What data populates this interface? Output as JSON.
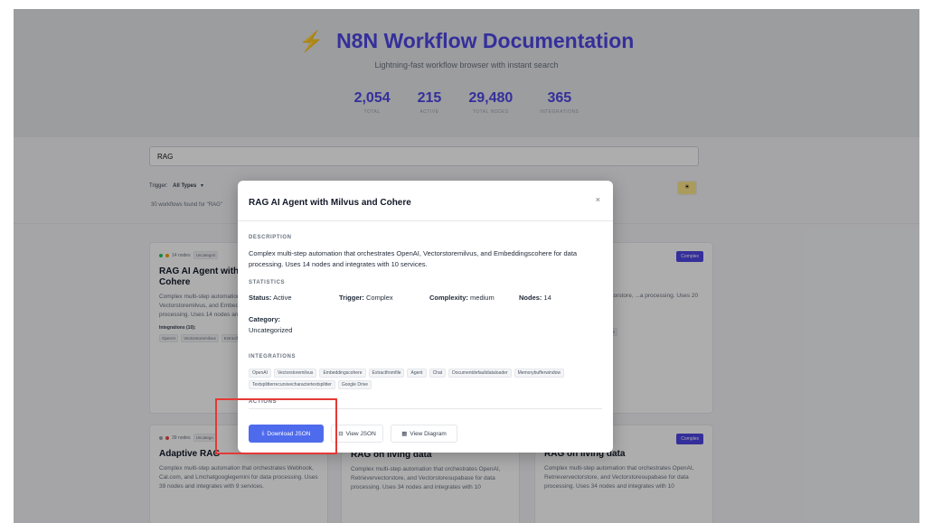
{
  "header": {
    "title": "N8N Workflow Documentation",
    "subtitle": "Lightning-fast workflow browser with instant search",
    "stats": [
      {
        "value": "2,054",
        "label": "TOTAL"
      },
      {
        "value": "215",
        "label": "ACTIVE"
      },
      {
        "value": "29,480",
        "label": "TOTAL NODES"
      },
      {
        "value": "365",
        "label": "INTEGRATIONS"
      }
    ]
  },
  "search": {
    "value": "RAG"
  },
  "filters": {
    "trigger_label": "Trigger:",
    "trigger_value": "All Types",
    "found_text": "30 workflows found for \"RAG\""
  },
  "cards": [
    {
      "nodes": "14 nodes",
      "category": "Uncategori",
      "title": "RAG AI Agent with Milvus and Cohere",
      "desc": "Complex multi-step automation that orchestrates OpenAI, Vectorstoremilvus, and Embeddingscohere for data processing. Uses 14 nodes and integrates with 10 services.",
      "integrations_label": "Integrations (10):",
      "chips": [
        "OpenAI",
        "Vectorstoremilvus",
        "Extractfromfile",
        "Agent"
      ]
    },
    {
      "category": "tion &",
      "complexity": "Complex",
      "desc": "...omation that ...rievervectorstore, ...a processing. Uses 20 ...ith 9 services.",
      "chips": [
        "...ee",
        "Lmchatgroq",
        "...ran",
        "+4"
      ]
    },
    {
      "nodes": "39 nodes",
      "category": "Uncatego",
      "title": "Adaptive RAG",
      "desc": "Complex multi-step automation that orchestrates Webhook, Cal.com, and Lmchatgooglegemini for data processing. Uses 39 nodes and integrates with 9 services."
    },
    {
      "title": "RAG on living data",
      "desc": "Complex multi-step automation that orchestrates OpenAI, Retrievervectorstore, and Vectorstoresupabase for data processing. Uses 34 nodes and integrates with 10"
    },
    {
      "category": "ted",
      "complexity": "Complex",
      "title": "RAG on living data",
      "desc": "Complex multi-step automation that orchestrates OpenAI, Retrievervectorstore, and Vectorstoresupabase for data processing. Uses 34 nodes and integrates with 10"
    }
  ],
  "modal": {
    "title": "RAG AI Agent with Milvus and Cohere",
    "close": "×",
    "description_heading": "DESCRIPTION",
    "description": "Complex multi-step automation that orchestrates OpenAI, Vectorstoremilvus, and Embeddingscohere for data processing. Uses 14 nodes and integrates with 10 services.",
    "statistics_heading": "STATISTICS",
    "status_label": "Status:",
    "status_value": "Active",
    "trigger_label": "Trigger:",
    "trigger_value": "Complex",
    "complexity_label": "Complexity:",
    "complexity_value": "medium",
    "nodes_label": "Nodes:",
    "nodes_value": "14",
    "category_label": "Category:",
    "category_value": "Uncategorized",
    "integrations_heading": "INTEGRATIONS",
    "integrations": [
      "OpenAI",
      "Vectorstoremilvus",
      "Embeddingscohere",
      "Extractfromfile",
      "Agent",
      "Chat",
      "Documentdefaultdataloader",
      "Memorybufferwindow",
      "Textsplitterrecursivecharactertextsplitter",
      "Google Drive"
    ],
    "actions_heading": "ACTIONS",
    "download_label": "Download JSON",
    "view_json_label": "View JSON",
    "view_diagram_label": "View Diagram"
  },
  "colors": {
    "accent": "#4f46e5",
    "primary_button": "#4f6bed",
    "highlight": "#e53935"
  }
}
